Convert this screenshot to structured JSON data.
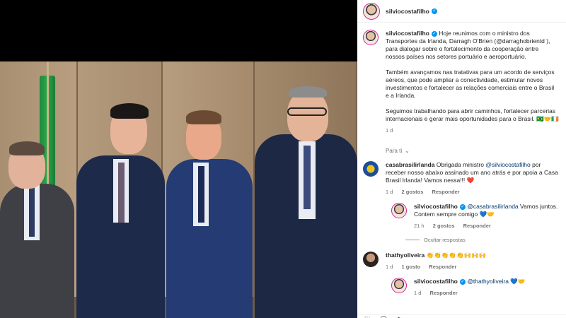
{
  "post": {
    "username": "silviocostafilho",
    "caption_paragraphs": [
      "Hoje reunimos com o ministro dos Transportes da Irlanda, Darragh O'Brien (@darraghobrientd ), para dialogar sobre o fortalecimento da cooperação entre nossos países nos setores portuário e aeroportuário.",
      "Também avançamos nas tratativas para um acordo de serviços aéreos, que pode ampliar a conectividade, estimular novos investimentos e fortalecer as relações comerciais entre o Brasil e a Irlanda.",
      "Seguimos trabalhando para abrir caminhos, fortalecer parcerias internacionais e gerar mais oportunidades para o Brasil. 🇧🇷🤝🇮🇪"
    ],
    "time": "1 d"
  },
  "section_label": "Para ti",
  "comments": [
    {
      "username": "casabrasilirlanda",
      "mention": "@silviocostafilho",
      "text_before": "Obrigada ministro",
      "text_after": "por receber nosso abaixo assinado um ano atrás e por apoia a Casa Brasil Irlanda! Vamos nessa!!! ❤️",
      "time": "1 d",
      "likes": "2 gostos",
      "reply": "Responder"
    },
    {
      "username": "silviocostafilho",
      "mention": "@casabrasilirlanda",
      "text": "Vamos juntos. Contem sempre comigo 💙🤝",
      "time": "21 h",
      "likes": "2 gostos",
      "reply": "Responder"
    },
    {
      "username": "thathyoliveira",
      "text": "👏👏👏👏👏🙌🙌🙌",
      "time": "1 d",
      "likes": "1 gosto",
      "reply": "Responder"
    },
    {
      "username": "silviocostafilho",
      "mention": "@thathyoliveira",
      "text": "💙🤝",
      "time": "1 d",
      "reply": "Responder"
    }
  ],
  "hide_replies": "Ocultar respostas",
  "icons": {
    "verified": "verified-badge-icon",
    "heart": "heart-icon",
    "chevron": "chevron-down-icon"
  },
  "colors": {
    "verified": "#0095f6",
    "mention": "#00376b",
    "muted": "#737373"
  }
}
